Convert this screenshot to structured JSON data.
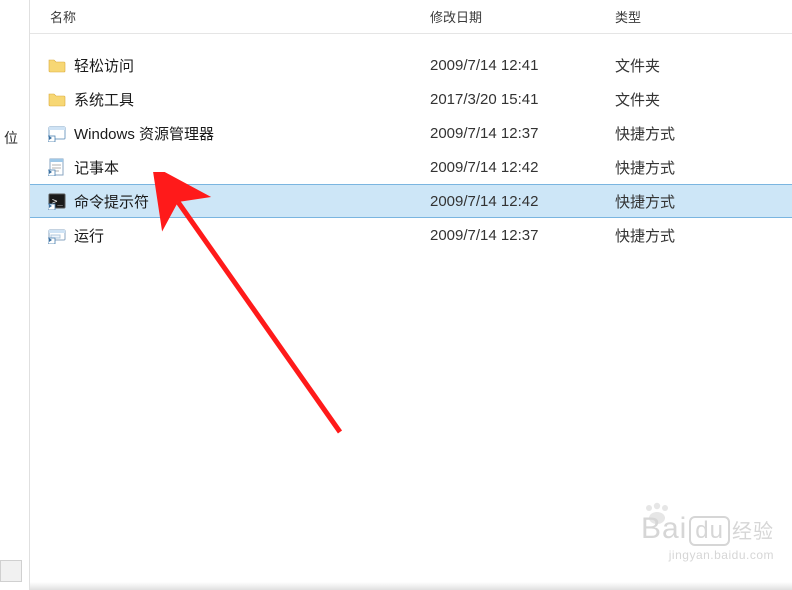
{
  "left_label": "位",
  "columns": {
    "name": "名称",
    "date": "修改日期",
    "type": "类型"
  },
  "rows": [
    {
      "icon": "folder",
      "name": "轻松访问",
      "date": "2009/7/14 12:41",
      "type": "文件夹",
      "selected": false
    },
    {
      "icon": "folder",
      "name": "系统工具",
      "date": "2017/3/20 15:41",
      "type": "文件夹",
      "selected": false
    },
    {
      "icon": "shortcut-explorer",
      "name": "Windows 资源管理器",
      "date": "2009/7/14 12:37",
      "type": "快捷方式",
      "selected": false
    },
    {
      "icon": "shortcut-notepad",
      "name": "记事本",
      "date": "2009/7/14 12:42",
      "type": "快捷方式",
      "selected": false
    },
    {
      "icon": "shortcut-cmd",
      "name": "命令提示符",
      "date": "2009/7/14 12:42",
      "type": "快捷方式",
      "selected": true
    },
    {
      "icon": "shortcut-run",
      "name": "运行",
      "date": "2009/7/14 12:37",
      "type": "快捷方式",
      "selected": false
    }
  ],
  "watermark": {
    "brand_left": "Bai",
    "brand_box": "du",
    "brand_right": "经验",
    "url": "jingyan.baidu.com"
  },
  "annotation": {
    "color": "#ff1a1a"
  }
}
